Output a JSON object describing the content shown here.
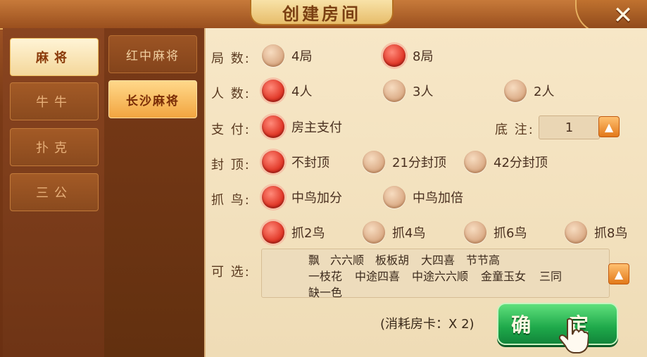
{
  "title": "创建房间",
  "close_icon": "close-icon",
  "categories": [
    {
      "label": "麻将",
      "active": true
    },
    {
      "label": "牛牛",
      "active": false
    },
    {
      "label": "扑克",
      "active": false
    },
    {
      "label": "三公",
      "active": false
    }
  ],
  "subcategories": [
    {
      "label": "红中麻将",
      "active": false
    },
    {
      "label": "长沙麻将",
      "active": true
    }
  ],
  "rounds": {
    "label": "局 数:",
    "options": [
      {
        "label": "4局",
        "selected": false
      },
      {
        "label": "8局",
        "selected": true
      }
    ]
  },
  "players": {
    "label": "人 数:",
    "options": [
      {
        "label": "4人",
        "selected": true
      },
      {
        "label": "3人",
        "selected": false
      },
      {
        "label": "2人",
        "selected": false
      }
    ]
  },
  "payment": {
    "label": "支 付:",
    "options": [
      {
        "label": "房主支付",
        "selected": true
      }
    ]
  },
  "stake": {
    "label": "底 注:",
    "value": "1"
  },
  "cap": {
    "label": "封 顶:",
    "options": [
      {
        "label": "不封顶",
        "selected": true
      },
      {
        "label": "21分封顶",
        "selected": false
      },
      {
        "label": "42分封顶",
        "selected": false
      }
    ]
  },
  "bird": {
    "label": "抓 鸟:",
    "options": [
      {
        "label": "中鸟加分",
        "selected": true
      },
      {
        "label": "中鸟加倍",
        "selected": false
      }
    ]
  },
  "bird_count": {
    "options": [
      {
        "label": "抓2鸟",
        "selected": true
      },
      {
        "label": "抓4鸟",
        "selected": false
      },
      {
        "label": "抓6鸟",
        "selected": false
      },
      {
        "label": "抓8鸟",
        "selected": false
      }
    ]
  },
  "optional": {
    "label": "可 选:",
    "tags": [
      "飘",
      "六六顺",
      "板板胡",
      "大四喜",
      "节节高",
      "一枝花",
      "中途四喜",
      "中途六六顺",
      "金童玉女",
      "三同",
      "缺一色"
    ]
  },
  "cost": "(消耗房卡：X 2)",
  "confirm": "确 定",
  "colors": {
    "accent": "#e23a2a",
    "confirm": "#1ea84a",
    "panel": "#f7e7c7"
  }
}
